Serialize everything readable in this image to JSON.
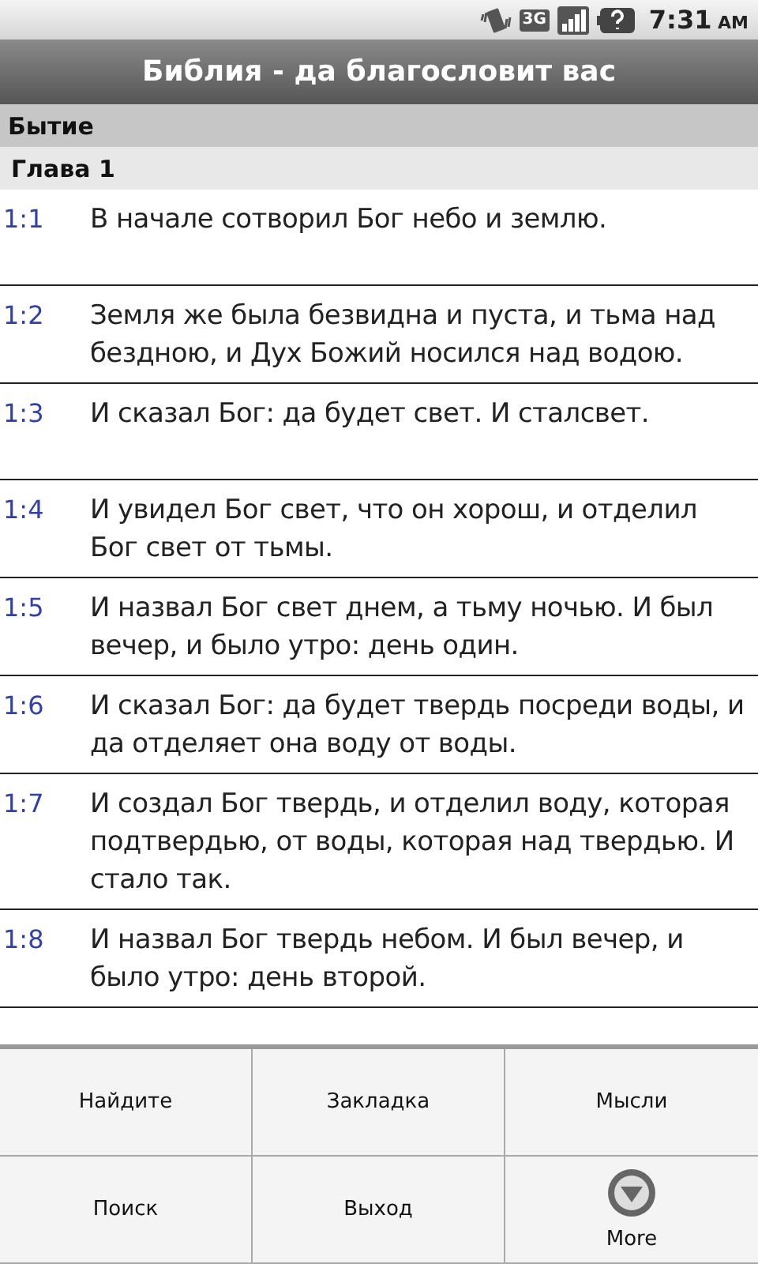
{
  "status_bar": {
    "network": "3G",
    "time": "7:31",
    "meridiem": "AM"
  },
  "title_bar": {
    "title": "Библия - да благословит вас"
  },
  "book": "Бытие",
  "chapter": "Глава 1",
  "verses": [
    {
      "number": "1:1",
      "text": "В начале сотворил Бог небо и землю."
    },
    {
      "number": "1:2",
      "text": "Земля же была безвидна и пуста, и тьма над бездною, и Дух Божий носился над водою."
    },
    {
      "number": "1:3",
      "text": "И сказал Бог: да будет свет. И сталсвет."
    },
    {
      "number": "1:4",
      "text": "И увидел Бог свет, что он хорош, и отделил Бог свет от тьмы."
    },
    {
      "number": "1:5",
      "text": "И назвал Бог свет днем, а тьму ночью. И был вечер, и было утро: день один."
    },
    {
      "number": "1:6",
      "text": "И сказал Бог: да будет твердь посреди воды, и да отделяет она воду от воды."
    },
    {
      "number": "1:7",
      "text": "И создал Бог твердь, и отделил воду, которая подтвердью, от воды, которая над твердью. И стало так."
    },
    {
      "number": "1:8",
      "text": "И назвал Бог твердь небом. И был вечер, и было утро: день второй."
    }
  ],
  "menu": [
    {
      "label": "Найдите",
      "kind": "text"
    },
    {
      "label": "Закладка",
      "kind": "text"
    },
    {
      "label": "Мысли",
      "kind": "text"
    },
    {
      "label": "Поиск",
      "kind": "text"
    },
    {
      "label": "Выход",
      "kind": "text"
    },
    {
      "label": "More",
      "kind": "more"
    }
  ]
}
